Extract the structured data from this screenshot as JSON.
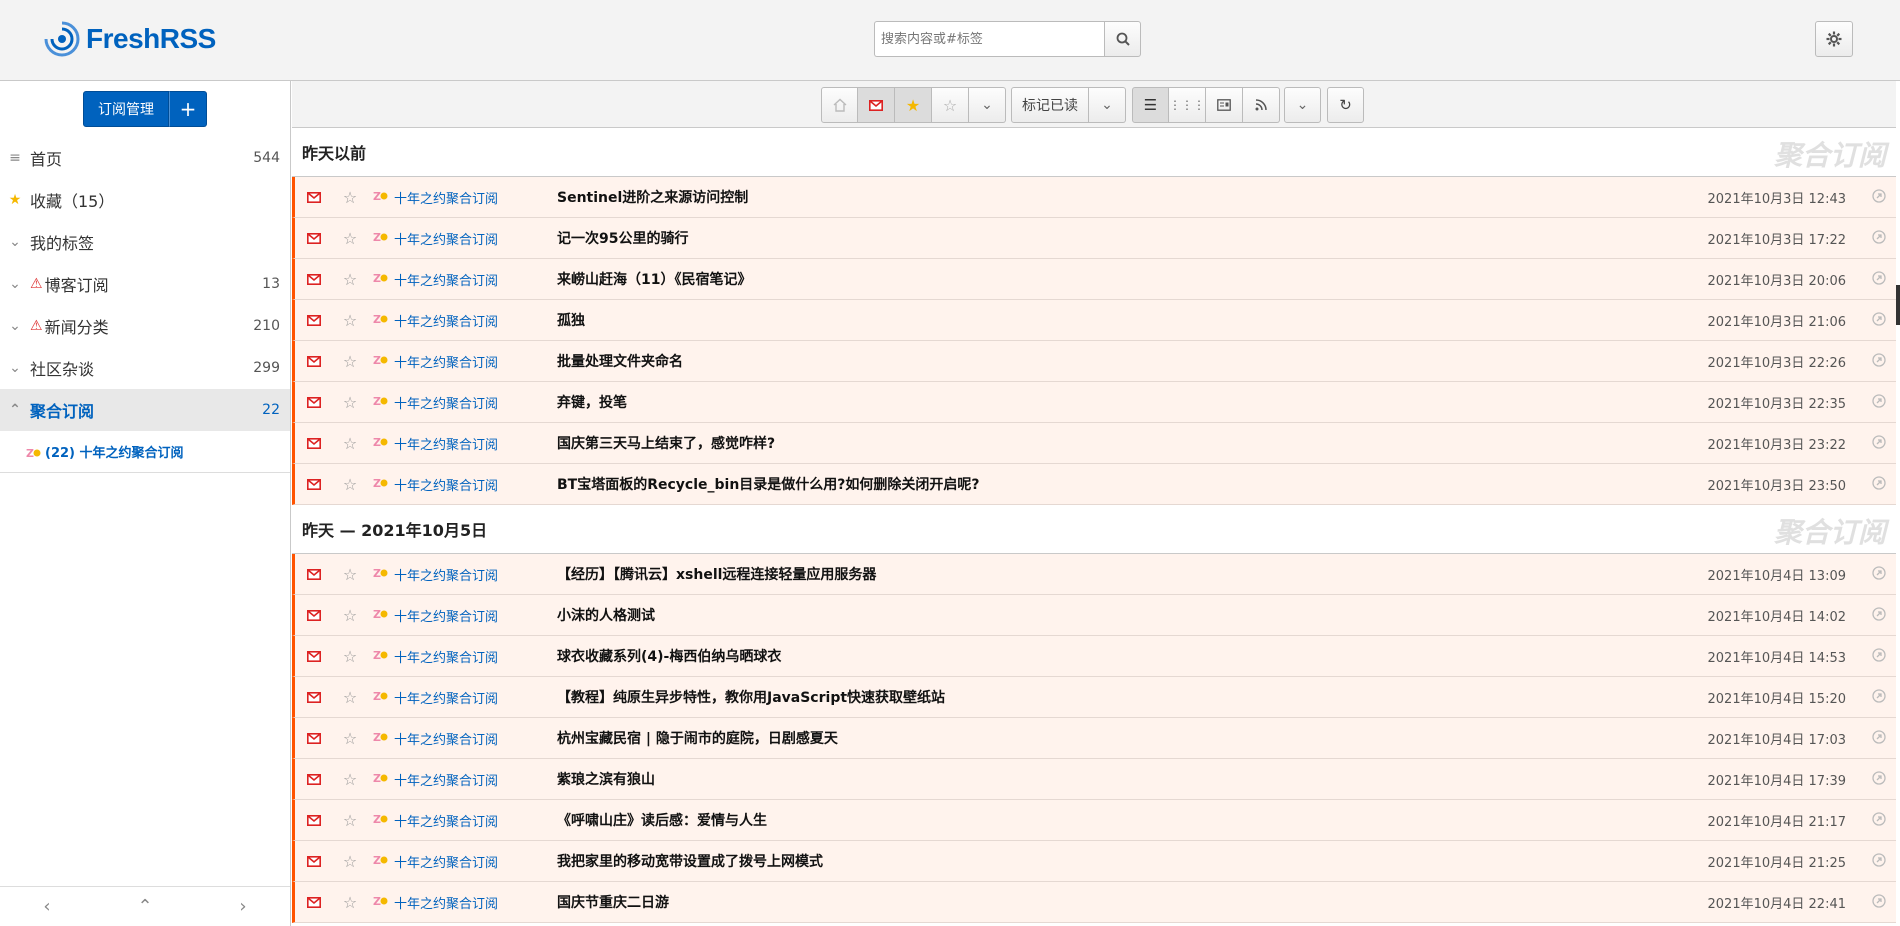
{
  "header": {
    "logo_text": "FreshRSS",
    "search_placeholder": "搜索内容或#标签"
  },
  "sidebar": {
    "subscription_button": "订阅管理",
    "add_button": "+",
    "items": [
      {
        "label": "首页",
        "count": "544",
        "icon": "list-icon"
      },
      {
        "label": "收藏（15）",
        "count": "",
        "icon": "star-icon"
      },
      {
        "label": "我的标签",
        "count": "",
        "icon": "chevron-down-icon"
      },
      {
        "label": "博客订阅",
        "count": "13",
        "icon": "chevron-down-icon",
        "warning": true
      },
      {
        "label": "新闻分类",
        "count": "210",
        "icon": "chevron-down-icon",
        "warning": true
      },
      {
        "label": "社区杂谈",
        "count": "299",
        "icon": "chevron-down-icon"
      },
      {
        "label": "聚合订阅",
        "count": "22",
        "icon": "chevron-up-icon",
        "active": true
      }
    ],
    "feed": {
      "label": "(22) 十年之约聚合订阅"
    }
  },
  "toolbar": {
    "mark_read_label": "标记已读"
  },
  "stream": {
    "groups": [
      {
        "title": "昨天以前",
        "category": "聚合订阅",
        "entries": [
          {
            "feed": "十年之约聚合订阅",
            "title": "Sentinel进阶之来源访问控制",
            "date": "2021年10月3日 12:43"
          },
          {
            "feed": "十年之约聚合订阅",
            "title": "记一次95公里的骑行",
            "date": "2021年10月3日 17:22"
          },
          {
            "feed": "十年之约聚合订阅",
            "title": "来崂山赶海（11）《民宿笔记》",
            "date": "2021年10月3日 20:06"
          },
          {
            "feed": "十年之约聚合订阅",
            "title": "孤独",
            "date": "2021年10月3日 21:06"
          },
          {
            "feed": "十年之约聚合订阅",
            "title": "批量处理文件夹命名",
            "date": "2021年10月3日 22:26"
          },
          {
            "feed": "十年之约聚合订阅",
            "title": "弃键，投笔",
            "date": "2021年10月3日 22:35"
          },
          {
            "feed": "十年之约聚合订阅",
            "title": "国庆第三天马上结束了，感觉咋样?",
            "date": "2021年10月3日 23:22"
          },
          {
            "feed": "十年之约聚合订阅",
            "title": "BT宝塔面板的Recycle_bin目录是做什么用?如何删除关闭开启呢?",
            "date": "2021年10月3日 23:50"
          }
        ]
      },
      {
        "title": "昨天 — 2021年10月5日",
        "category": "聚合订阅",
        "entries": [
          {
            "feed": "十年之约聚合订阅",
            "title": "【经历】【腾讯云】xshell远程连接轻量应用服务器",
            "date": "2021年10月4日 13:09"
          },
          {
            "feed": "十年之约聚合订阅",
            "title": "小沫的人格测试",
            "date": "2021年10月4日 14:02"
          },
          {
            "feed": "十年之约聚合订阅",
            "title": "球衣收藏系列(4)-梅西伯纳乌晒球衣",
            "date": "2021年10月4日 14:53"
          },
          {
            "feed": "十年之约聚合订阅",
            "title": "【教程】纯原生异步特性，教你用JavaScript快速获取壁纸站",
            "date": "2021年10月4日 15:20"
          },
          {
            "feed": "十年之约聚合订阅",
            "title": "杭州宝藏民宿 | 隐于闹市的庭院，日剧感夏天",
            "date": "2021年10月4日 17:03"
          },
          {
            "feed": "十年之约聚合订阅",
            "title": "紫琅之滨有狼山",
            "date": "2021年10月4日 17:39"
          },
          {
            "feed": "十年之约聚合订阅",
            "title": "《呼啸山庄》读后感：爱情与人生",
            "date": "2021年10月4日 21:17"
          },
          {
            "feed": "十年之约聚合订阅",
            "title": "我把家里的移动宽带设置成了拨号上网模式",
            "date": "2021年10月4日 21:25"
          },
          {
            "feed": "十年之约聚合订阅",
            "title": "国庆节重庆二日游",
            "date": "2021年10月4日 22:41"
          }
        ]
      }
    ]
  },
  "colors": {
    "brand": "#0062be",
    "unread_bg": "#fff3ed",
    "unread_border": "#ff5300"
  }
}
